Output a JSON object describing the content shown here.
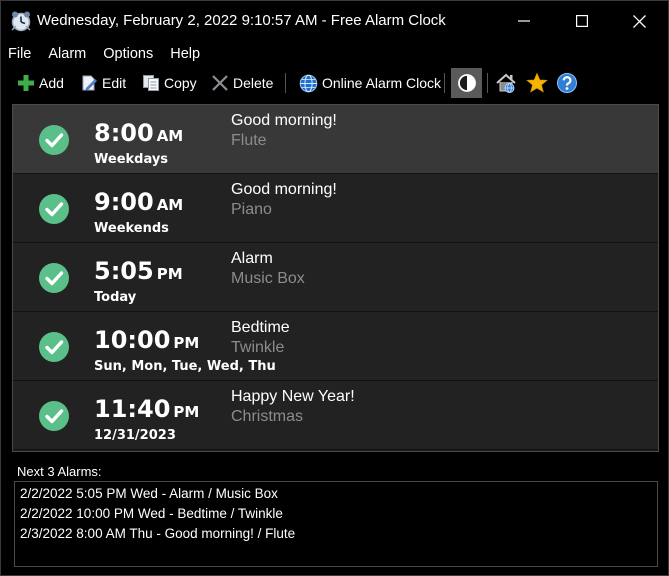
{
  "window": {
    "title": "Wednesday, February 2, 2022 9:10:57 AM - Free Alarm Clock",
    "minimize_icon": "minimize-icon",
    "maximize_icon": "maximize-icon",
    "close_icon": "close-icon"
  },
  "menu": [
    {
      "label": "File"
    },
    {
      "label": "Alarm"
    },
    {
      "label": "Options"
    },
    {
      "label": "Help"
    }
  ],
  "toolbar": {
    "add_label": "Add",
    "edit_label": "Edit",
    "copy_label": "Copy",
    "delete_label": "Delete",
    "online_label": "Online Alarm Clock",
    "icons": [
      "plus-icon",
      "edit-icon",
      "copy-icon",
      "delete-icon",
      "globe-icon",
      "theme-icon",
      "home-icon",
      "star-icon",
      "help-icon"
    ]
  },
  "alarms": [
    {
      "time": "8:00",
      "ampm": "AM",
      "days": "Weekdays",
      "message": "Good morning!",
      "sound": "Flute",
      "enabled": true
    },
    {
      "time": "9:00",
      "ampm": "AM",
      "days": "Weekends",
      "message": "Good morning!",
      "sound": "Piano",
      "enabled": true
    },
    {
      "time": "5:05",
      "ampm": "PM",
      "days": "Today",
      "message": "Alarm",
      "sound": "Music Box",
      "enabled": true
    },
    {
      "time": "10:00",
      "ampm": "PM",
      "days": "Sun, Mon, Tue, Wed, Thu",
      "message": "Bedtime",
      "sound": "Twinkle",
      "enabled": true
    },
    {
      "time": "11:40",
      "ampm": "PM",
      "days": "12/31/2023",
      "message": "Happy New Year!",
      "sound": "Christmas",
      "enabled": true
    }
  ],
  "next": {
    "label": "Next 3 Alarms:",
    "lines": [
      "2/2/2022 5:05 PM Wed - Alarm / Music Box",
      "2/2/2022 10:00 PM Wed - Bedtime / Twinkle",
      "2/3/2022 8:00 AM Thu - Good morning! / Flute"
    ]
  },
  "colors": {
    "background": "#000000",
    "row": "#222222",
    "row_selected": "#383838",
    "check_green": "#5bbf8a",
    "sound_text": "#8c8c8c",
    "star": "#f5b400",
    "help_blue": "#2f7fd6"
  }
}
